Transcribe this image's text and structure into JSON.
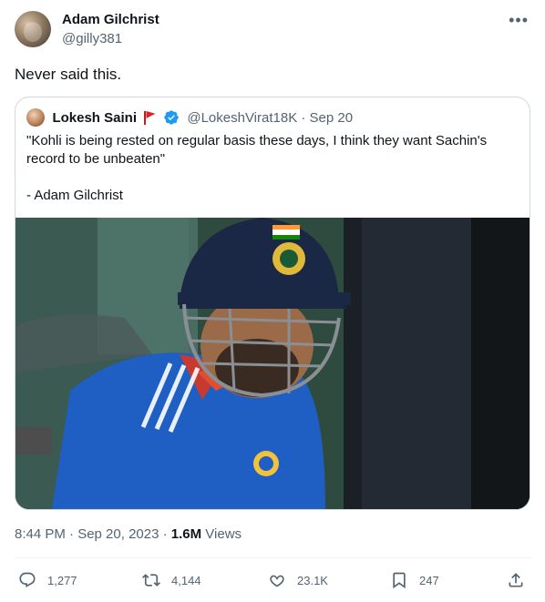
{
  "author": {
    "name": "Adam Gilchrist",
    "handle": "@gilly381",
    "avatar_icon": "profile-photo"
  },
  "more_icon": "more-horizontal-icon",
  "tweet": {
    "text": "Never said this."
  },
  "quoted": {
    "name": "Lokesh Saini",
    "flag_icon": "red-flag-emoji",
    "verified_icon": "verified-badge",
    "handle_date": "@LokeshVirat18K · Sep 20",
    "text_lines": [
      "\"Kohli is being rested on regular basis these days, I think they want Sachin's",
      "record to be unbeaten\"",
      "- Adam Gilchrist"
    ],
    "media_alt": "photo of cricketer in blue jersey and helmet"
  },
  "meta": {
    "time_date": "8:44 PM · Sep 20, 2023 · ",
    "views_count": "1.6M",
    "views_label": " Views"
  },
  "actions": {
    "replies": "1,277",
    "retweets": "4,144",
    "likes": "23.1K",
    "bookmarks": "247"
  },
  "colors": {
    "text": "#0f1419",
    "secondary": "#536471",
    "border": "#cfd9de",
    "verified": "#1d9bf0",
    "jersey": "#1f5fc4"
  }
}
